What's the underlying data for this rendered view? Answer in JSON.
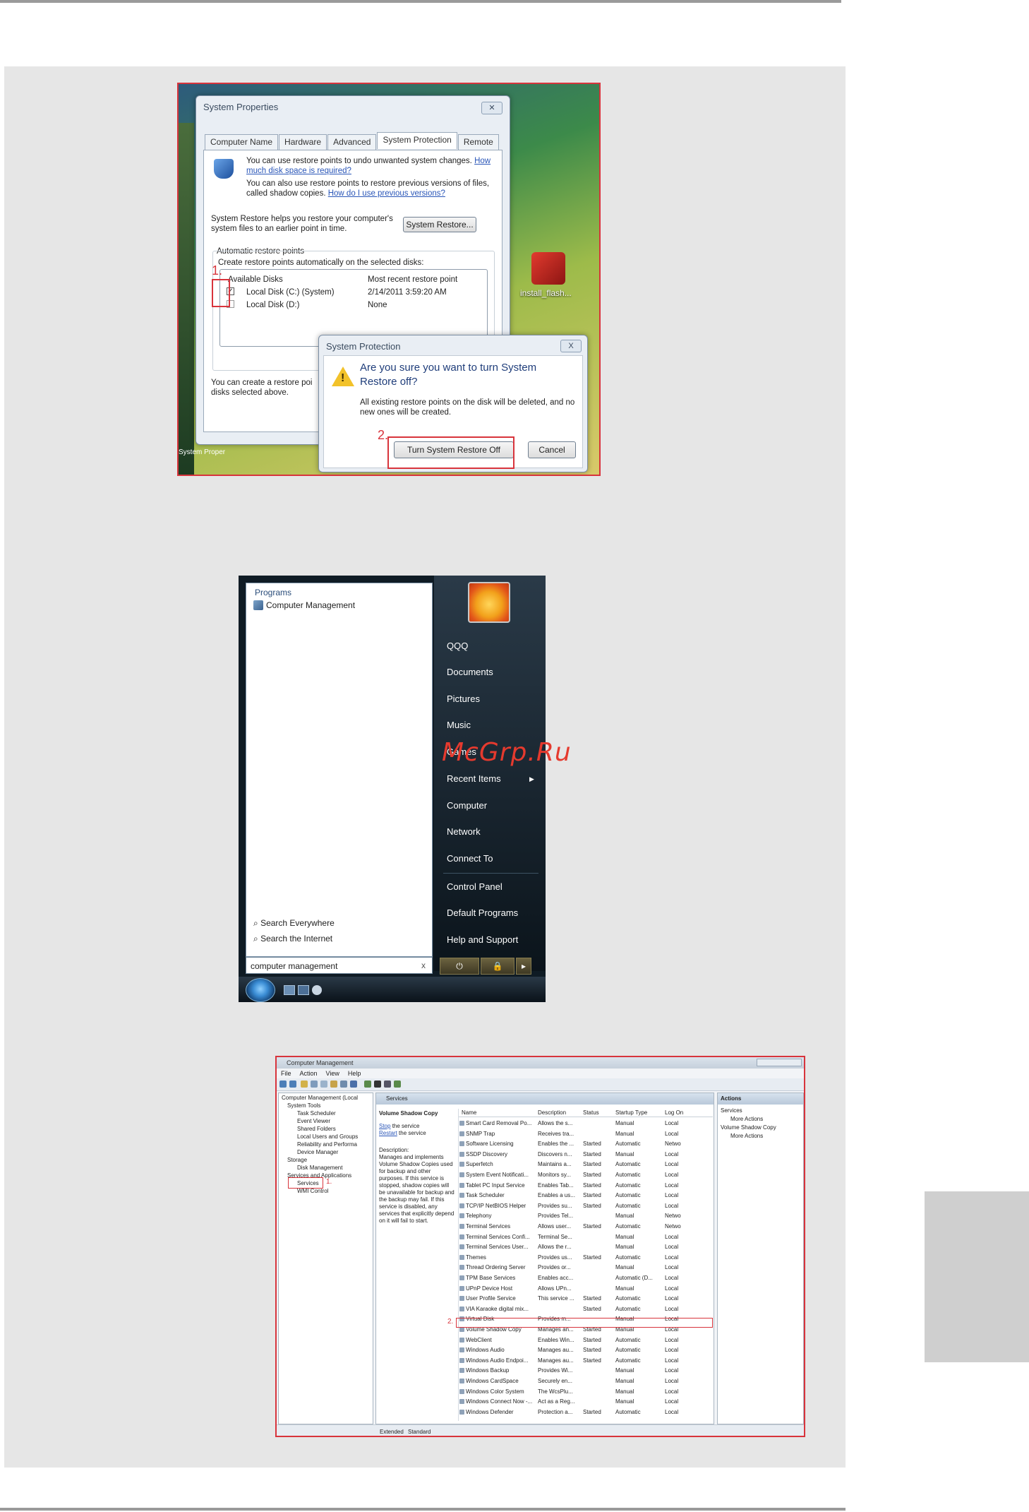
{
  "watermark": "McGrp.Ru",
  "shot1": {
    "window_title": "System Properties",
    "tabs": [
      "Computer Name",
      "Hardware",
      "Advanced",
      "System Protection",
      "Remote"
    ],
    "intro1_a": "You can use restore points to undo unwanted system changes.",
    "intro1_link": "How much disk space is required?",
    "intro2_a": "You can also use restore points to restore previous versions of files, called shadow copies.",
    "intro2_link": "How do I use previous versions?",
    "restore_text": "System Restore helps you restore your computer's system files to an earlier point in time.",
    "restore_button": "System Restore...",
    "auto_group": "Automatic restore points",
    "auto_desc": "Create restore points automatically on the selected disks:",
    "col_disks": "Available Disks",
    "col_recent": "Most recent restore point",
    "disk1_name": "Local Disk (C:) (System)",
    "disk1_date": "2/14/2011 3:59:20 AM",
    "disk2_name": "Local Disk (D:)",
    "disk2_date": "None",
    "create_text": "You can create a restore poi",
    "create_text2": "disks selected above.",
    "desktop_icon_label": "install_flash...",
    "taskbar_label": "System Proper",
    "step1": "1.",
    "step2": "2.",
    "dialog": {
      "title": "System Protection",
      "question": "Are you sure you want to turn System Restore off?",
      "detail": "All existing restore points on the disk will be deleted, and no new ones will be created.",
      "confirm": "Turn System Restore Off",
      "cancel": "Cancel",
      "close": "X"
    }
  },
  "shot2": {
    "programs_header": "Programs",
    "program_result": "Computer Management",
    "right_items": [
      "QQQ",
      "Documents",
      "Pictures",
      "Music",
      "Games",
      "Recent Items",
      "Computer",
      "Network",
      "Connect To",
      "Control Panel",
      "Default Programs",
      "Help and Support"
    ],
    "search_everywhere": "Search Everywhere",
    "search_internet": "Search the Internet",
    "search_value": "computer management",
    "clear": "x"
  },
  "shot3": {
    "title": "Computer Management",
    "menu": [
      "File",
      "Action",
      "View",
      "Help"
    ],
    "tree": [
      "Computer Management (Local",
      "System Tools",
      "Task Scheduler",
      "Event Viewer",
      "Shared Folders",
      "Local Users and Groups",
      "Reliability and Performa",
      "Device Manager",
      "Storage",
      "Disk Management",
      "Services and Applications",
      "Services",
      "WMI Control"
    ],
    "services_header": "Services",
    "selected_service": "Volume Shadow Copy",
    "stop_link": "Stop",
    "stop_rest": "the service",
    "restart_link": "Restart",
    "restart_rest": "the service",
    "desc_label": "Description:",
    "description": "Manages and implements Volume Shadow Copies used for backup and other purposes. If this service is stopped, shadow copies will be unavailable for backup and the backup may fail. If this service is disabled, any services that explicitly depend on it will fail to start.",
    "columns": [
      "Name",
      "Description",
      "Status",
      "Startup Type",
      "Log On"
    ],
    "rows": [
      [
        "Smart Card Removal Po...",
        "Allows the s...",
        "",
        "Manual",
        "Local"
      ],
      [
        "SNMP Trap",
        "Receives tra...",
        "",
        "Manual",
        "Local"
      ],
      [
        "Software Licensing",
        "Enables the ...",
        "Started",
        "Automatic",
        "Netwo"
      ],
      [
        "SSDP Discovery",
        "Discovers n...",
        "Started",
        "Manual",
        "Local"
      ],
      [
        "Superfetch",
        "Maintains a...",
        "Started",
        "Automatic",
        "Local"
      ],
      [
        "System Event Notificati...",
        "Monitors sy...",
        "Started",
        "Automatic",
        "Local"
      ],
      [
        "Tablet PC Input Service",
        "Enables Tab...",
        "Started",
        "Automatic",
        "Local"
      ],
      [
        "Task Scheduler",
        "Enables a us...",
        "Started",
        "Automatic",
        "Local"
      ],
      [
        "TCP/IP NetBIOS Helper",
        "Provides su...",
        "Started",
        "Automatic",
        "Local"
      ],
      [
        "Telephony",
        "Provides Tel...",
        "",
        "Manual",
        "Netwo"
      ],
      [
        "Terminal Services",
        "Allows user...",
        "Started",
        "Automatic",
        "Netwo"
      ],
      [
        "Terminal Services Confi...",
        "Terminal Se...",
        "",
        "Manual",
        "Local"
      ],
      [
        "Terminal Services User...",
        "Allows the r...",
        "",
        "Manual",
        "Local"
      ],
      [
        "Themes",
        "Provides us...",
        "Started",
        "Automatic",
        "Local"
      ],
      [
        "Thread Ordering Server",
        "Provides or...",
        "",
        "Manual",
        "Local"
      ],
      [
        "TPM Base Services",
        "Enables acc...",
        "",
        "Automatic (D...",
        "Local"
      ],
      [
        "UPnP Device Host",
        "Allows UPn...",
        "",
        "Manual",
        "Local"
      ],
      [
        "User Profile Service",
        "This service ...",
        "Started",
        "Automatic",
        "Local"
      ],
      [
        "VIA Karaoke digital mix...",
        "",
        "Started",
        "Automatic",
        "Local"
      ],
      [
        "Virtual Disk",
        "Provides m...",
        "",
        "Manual",
        "Local"
      ],
      [
        "Volume Shadow Copy",
        "Manages an...",
        "Started",
        "Manual",
        "Local"
      ],
      [
        "WebClient",
        "Enables Win...",
        "Started",
        "Automatic",
        "Local"
      ],
      [
        "Windows Audio",
        "Manages au...",
        "Started",
        "Automatic",
        "Local"
      ],
      [
        "Windows Audio Endpoi...",
        "Manages au...",
        "Started",
        "Automatic",
        "Local"
      ],
      [
        "Windows Backup",
        "Provides Wi...",
        "",
        "Manual",
        "Local"
      ],
      [
        "Windows CardSpace",
        "Securely en...",
        "",
        "Manual",
        "Local"
      ],
      [
        "Windows Color System",
        "The WcsPlu...",
        "",
        "Manual",
        "Local"
      ],
      [
        "Windows Connect Now -...",
        "Act as a Reg...",
        "",
        "Manual",
        "Local"
      ],
      [
        "Windows Defender",
        "Protection a...",
        "Started",
        "Automatic",
        "Local"
      ]
    ],
    "actions_header": "Actions",
    "actions": [
      "Services",
      "More Actions",
      "Volume Shadow Copy",
      "More Actions"
    ],
    "footer_tabs": [
      "Extended",
      "Standard"
    ],
    "step1": "1.",
    "step2": "2."
  }
}
